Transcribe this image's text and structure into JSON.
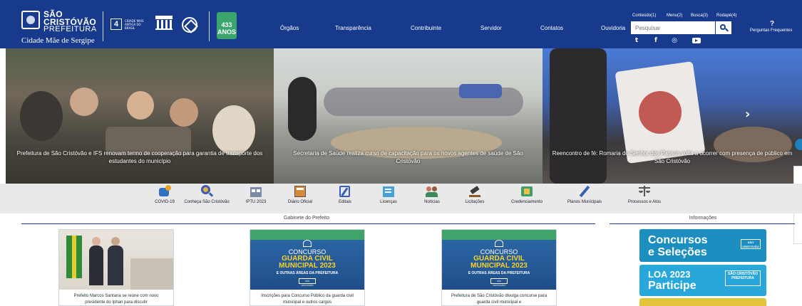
{
  "header": {
    "logo": {
      "line1": "SÃO",
      "line2": "CRISTÓVÃO",
      "line3": "PREFEITURA",
      "tagline": "Cidade Mãe de Sergipe"
    },
    "badge_number": "4",
    "cidade_text": "CIDADE MAIS ANTIGA DO BRASIL",
    "anos_text": "433 ANOS",
    "nav": [
      "Órgãos",
      "Transparência",
      "Contribuinte",
      "Servidor",
      "Contatos",
      "Ouvidoria"
    ],
    "accessibility": [
      "Conteúdo(1)",
      "Menu(2)",
      "Busca(3)",
      "Rodapé(4)"
    ],
    "search_placeholder": "Pesquisar",
    "faq_mark": "?",
    "faq_label": "Perguntas Frequentes",
    "colors": {
      "header_bg": "#173a8c",
      "accent": "#1f7fbf"
    }
  },
  "social_icons": [
    "twitter-icon",
    "facebook-icon",
    "instagram-icon",
    "youtube-icon"
  ],
  "carousel": {
    "slides": [
      {
        "caption": "Prefeitura de São Cristóvão e IFS renovam termo de cooperação para garantia de transporte dos estudantes do município"
      },
      {
        "caption": "Secretaria de Saúde realiza curso de capacitação para os novos agentes de saúde de São Cristóvão"
      },
      {
        "caption": "Reencontro de fé: Romaria do Senhor dos Passos volta a ocorrer com presença de público em São Cristóvão"
      }
    ],
    "next_arrow": "›"
  },
  "services": [
    {
      "label": "COVID-19",
      "icon": "virus-icon"
    },
    {
      "label": "Conheça São Cristóvão",
      "icon": "magnifier-map-icon"
    },
    {
      "label": "IPTU 2023",
      "icon": "house-calculator-icon"
    },
    {
      "label": "Diário Oficial",
      "icon": "newspaper-icon"
    },
    {
      "label": "Editais",
      "icon": "pen-document-icon"
    },
    {
      "label": "Licenças",
      "icon": "license-icon"
    },
    {
      "label": "Notícias",
      "icon": "people-icon"
    },
    {
      "label": "Licitações",
      "icon": "gavel-icon"
    },
    {
      "label": "Credenciamento",
      "icon": "id-card-icon"
    },
    {
      "label": "Planos Municipais",
      "icon": "pencil-icon"
    },
    {
      "label": "Processos e Atos",
      "icon": "scales-icon"
    }
  ],
  "sections": {
    "gabinete_title": "Gabinete do Prefeito",
    "info_title": "Informações"
  },
  "cards": [
    {
      "text": "Prefeito Marcos Santana se reúne com novo presidente do Iphan para discutir"
    },
    {
      "text": "Inscrições para Concurso Público da guarda civil municipal e outros cargos"
    },
    {
      "text": "Prefeitura de São Cristóvão divulga concurse para guarda civil municipal e"
    }
  ],
  "concurso": {
    "line1": "CONCURSO",
    "line2": "GUARDA CIVIL",
    "line3": "MUNICIPAL 2023",
    "line4": "E OUTRAS ÁREAS DA PREFEITURA",
    "logo": "SÃO CRISTÓVÃO"
  },
  "banners": [
    {
      "title1": "Concursos",
      "title2": "e Seleções",
      "logo": "SÃO CRISTÓVÃO",
      "color": "#1c8fc0"
    },
    {
      "title1": "LOA 2023",
      "title2": "Participe",
      "logo": "SÃO CRISTÓVÃO PREFEITURA",
      "color": "#27a7da"
    },
    {
      "color": "#e2c33c"
    }
  ]
}
